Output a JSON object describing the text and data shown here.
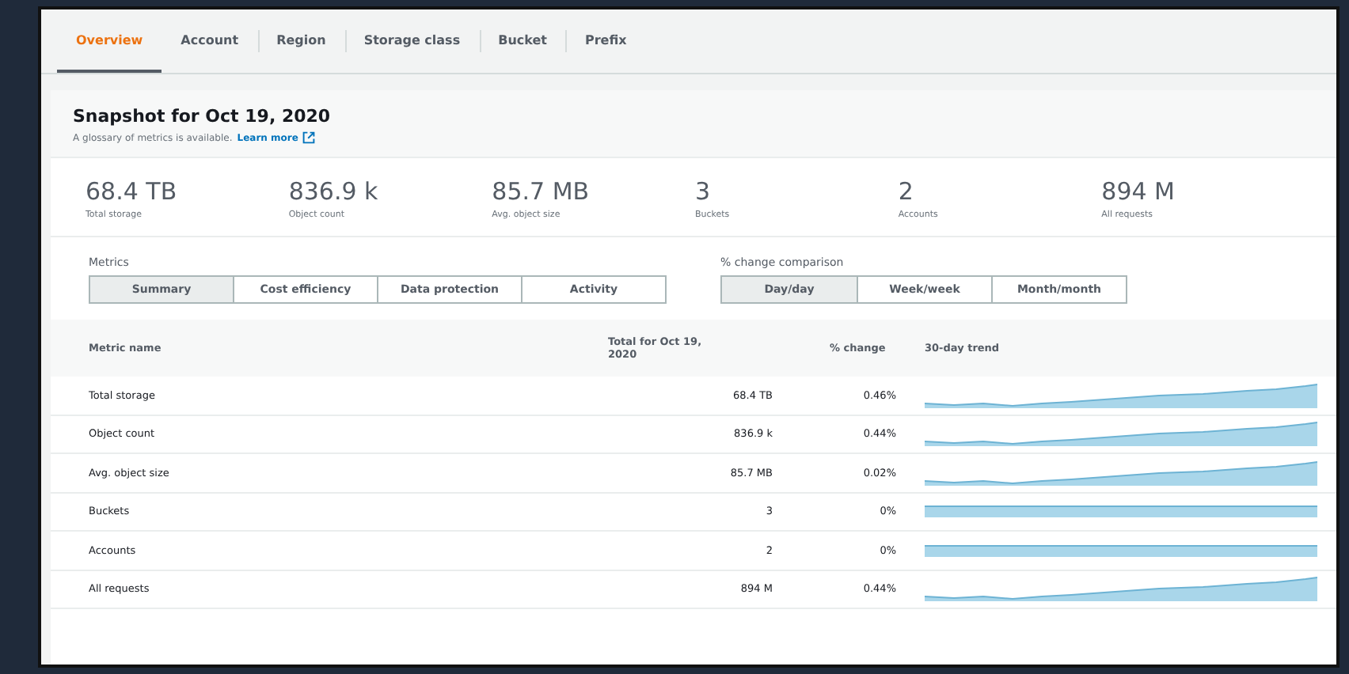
{
  "tabs": [
    {
      "label": "Overview",
      "selected": true
    },
    {
      "label": "Account",
      "selected": false
    },
    {
      "label": "Region",
      "selected": false
    },
    {
      "label": "Storage class",
      "selected": false
    },
    {
      "label": "Bucket",
      "selected": false
    },
    {
      "label": "Prefix",
      "selected": false
    }
  ],
  "snapshot": {
    "title": "Snapshot for Oct 19, 2020",
    "description": "A glossary of metrics is available.",
    "link": "Learn more"
  },
  "stats": [
    {
      "value": "68.4 TB",
      "label": "Total storage"
    },
    {
      "value": "836.9 k",
      "label": "Object count"
    },
    {
      "value": "85.7 MB",
      "label": "Avg. object size"
    },
    {
      "value": "3",
      "label": "Buckets"
    },
    {
      "value": "2",
      "label": "Accounts"
    },
    {
      "value": "894 M",
      "label": "All requests"
    }
  ],
  "metrics": {
    "label": "Metrics",
    "options": [
      {
        "label": "Summary",
        "selected": true
      },
      {
        "label": "Cost efficiency",
        "selected": false
      },
      {
        "label": "Data protection",
        "selected": false
      },
      {
        "label": "Activity",
        "selected": false
      }
    ]
  },
  "comparison": {
    "label": "% change comparison",
    "options": [
      {
        "label": "Day/day",
        "selected": true
      },
      {
        "label": "Week/week",
        "selected": false
      },
      {
        "label": "Month/month",
        "selected": false
      }
    ]
  },
  "table": {
    "columns": [
      "Metric name",
      "Total for Oct 19, 2020",
      "% change",
      "30-day trend"
    ],
    "rows": [
      {
        "name": "Total storage",
        "total": "68.4 TB",
        "change": "0.46%",
        "kind": "rising"
      },
      {
        "name": "Object count",
        "total": "836.9 k",
        "change": "0.44%",
        "kind": "rising"
      },
      {
        "name": "Avg. object size",
        "total": "85.7 MB",
        "change": "0.02%",
        "kind": "rising"
      },
      {
        "name": "Buckets",
        "total": "3",
        "change": "0%",
        "kind": "flat"
      },
      {
        "name": "Accounts",
        "total": "2",
        "change": "0%",
        "kind": "flat"
      },
      {
        "name": "All requests",
        "total": "894 M",
        "change": "0.44%",
        "kind": "rising"
      }
    ]
  }
}
